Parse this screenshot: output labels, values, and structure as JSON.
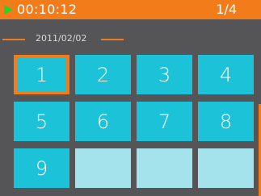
{
  "header": {
    "timer": "00:10:12",
    "page_indicator": "1/4",
    "play_icon": "play-icon"
  },
  "date": "2011/02/02",
  "tiles": [
    "1",
    "2",
    "3",
    "4",
    "5",
    "6",
    "7",
    "8",
    "9",
    "",
    "",
    ""
  ],
  "selected_tile": "1",
  "colors": {
    "accent": "#f27b1a",
    "tile": "#1cc3d8",
    "tile_empty": "#a4e3ec",
    "play": "#2ad12a",
    "background": "#555557"
  }
}
